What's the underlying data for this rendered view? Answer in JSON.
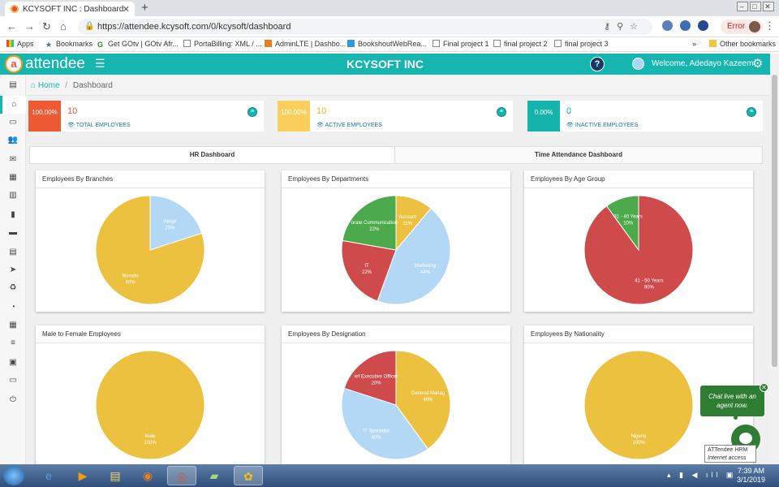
{
  "browser": {
    "tab_title": "KCYSOFT INC : Dashboard",
    "url": "https://attendee.kcysoft.com/0/kcysoft/dashboard",
    "error_label": "Error",
    "bookmarks": [
      "Apps",
      "Bookmarks",
      "Get GOtv | GOtv Afr...",
      "PortaBilling: XML / ...",
      "AdminLTE | Dashbo...",
      "BookshoutWebRea...",
      "Final project 1",
      "final project 2",
      "final project 3",
      "Other bookmarks"
    ]
  },
  "app": {
    "logo_letter": "a",
    "logo_text": "attendee",
    "company": "KCYSOFT INC",
    "welcome": "Welcome, Adedayo Kazeem"
  },
  "breadcrumb": {
    "home": "Home",
    "separator": "/",
    "current": "Dashboard"
  },
  "stats": [
    {
      "percent": "100.00%",
      "value": "10",
      "label": "TOTAL EMPLOYEES",
      "color": "#ee5a33"
    },
    {
      "percent": "100.00%",
      "value": "10",
      "label": "ACTIVE EMPLOYEES",
      "color": "#fbcf5b"
    },
    {
      "percent": "0.00%",
      "value": "0",
      "label": "INACTIVE EMPLOYEES",
      "color": "#14b3ac"
    }
  ],
  "tabs": {
    "hr": "HR Dashboard",
    "time": "Time Attendance Dashboard"
  },
  "panels": {
    "branches": "Employees By Branches",
    "departments": "Employees By Departments",
    "age": "Employees By Age Group",
    "gender": "Male to Female Employees",
    "designation": "Employees By Designation",
    "nationality": "Employees By Nationality"
  },
  "chart_data": [
    {
      "type": "pie",
      "title": "Employees By Branches",
      "slices": [
        {
          "label": "Abuja",
          "pct": "20%",
          "value": 20,
          "color": "#b3d8f5"
        },
        {
          "label": "Ikorodu",
          "pct": "80%",
          "value": 80,
          "color": "#ecc13f"
        }
      ]
    },
    {
      "type": "pie",
      "title": "Employees By Departments",
      "slices": [
        {
          "label": "Account",
          "pct": "11%",
          "value": 11,
          "color": "#ecc13f"
        },
        {
          "label": "Marketing",
          "pct": "44%",
          "value": 44,
          "color": "#b3d8f5"
        },
        {
          "label": "IT",
          "pct": "22%",
          "value": 22,
          "color": "#cf4a4a"
        },
        {
          "label": "orate Communication",
          "pct": "22%",
          "value": 22,
          "color": "#4caa4c"
        }
      ]
    },
    {
      "type": "pie",
      "title": "Employees By Age Group",
      "slices": [
        {
          "label": "41 - 50 Years",
          "pct": "90%",
          "value": 90,
          "color": "#cf4a4a"
        },
        {
          "label": "31 - 40 Years",
          "pct": "10%",
          "value": 10,
          "color": "#4caa4c"
        }
      ]
    },
    {
      "type": "pie",
      "title": "Male to Female Employees",
      "slices": [
        {
          "label": "Male",
          "pct": "100%",
          "value": 100,
          "color": "#ecc13f"
        }
      ]
    },
    {
      "type": "pie",
      "title": "Employees By Designation",
      "slices": [
        {
          "label": "General Manag",
          "pct": "40%",
          "value": 40,
          "color": "#ecc13f"
        },
        {
          "label": "IT Specialist",
          "pct": "40%",
          "value": 40,
          "color": "#b3d8f5"
        },
        {
          "label": "ief Executive Officer",
          "pct": "20%",
          "value": 20,
          "color": "#cf4a4a"
        }
      ]
    },
    {
      "type": "pie",
      "title": "Employees By Nationality",
      "slices": [
        {
          "label": "Nigeria",
          "pct": "100%",
          "value": 100,
          "color": "#ecc13f"
        }
      ]
    }
  ],
  "chat": {
    "line1": "Chat live with an",
    "line2": "agent now.",
    "tooltip_title": "ATTendee HRM",
    "tooltip_sub": "Internet access"
  },
  "taskbar": {
    "time": "7:39 AM",
    "date": "3/1/2019"
  }
}
